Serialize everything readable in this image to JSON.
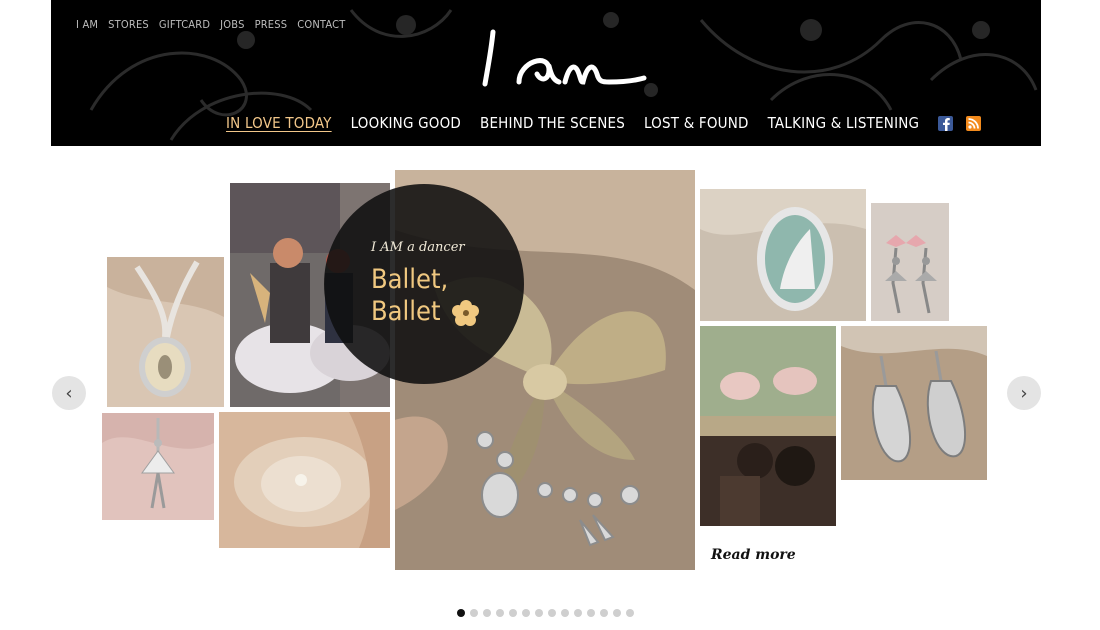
{
  "header": {
    "top_nav": [
      "I AM",
      "STORES",
      "GIFTCARD",
      "JOBS",
      "PRESS",
      "CONTACT"
    ],
    "logo_text": "I am",
    "main_nav": [
      {
        "label": "IN LOVE TODAY",
        "active": true
      },
      {
        "label": "LOOKING GOOD",
        "active": false
      },
      {
        "label": "BEHIND THE SCENES",
        "active": false
      },
      {
        "label": "LOST & FOUND",
        "active": false
      },
      {
        "label": "TALKING & LISTENING",
        "active": false
      }
    ],
    "social": [
      "facebook-icon",
      "rss-icon"
    ]
  },
  "feature": {
    "kicker": "I AM a dancer",
    "title_line1": "Ballet,",
    "title_line2": "Ballet",
    "read_more": "Read more"
  },
  "carousel": {
    "prev_arrow": "‹",
    "next_arrow": "›",
    "total_slides": 14,
    "active_slide": 1
  },
  "colors": {
    "header_bg": "#000000",
    "accent": "#f2c78a",
    "circle_text": "#f0c880",
    "facebook": "#3b5998",
    "rss": "#f38b1d"
  }
}
